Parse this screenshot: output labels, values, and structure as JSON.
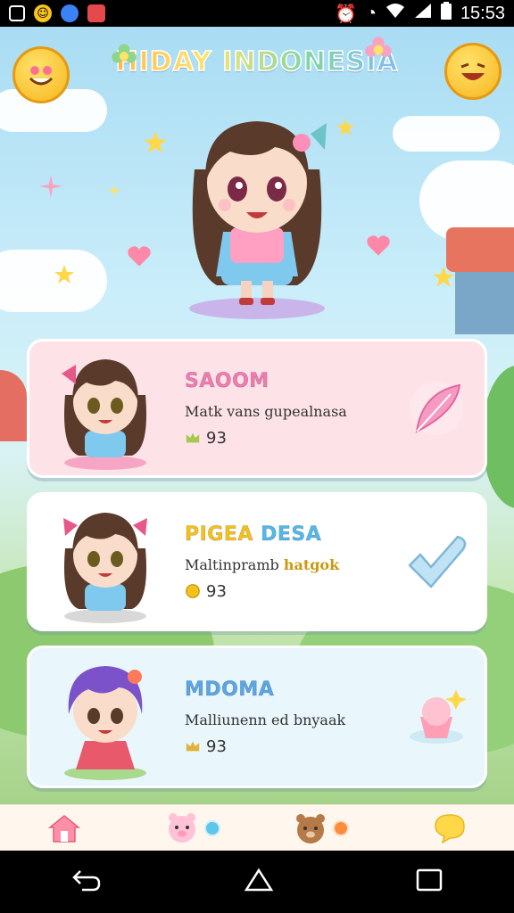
{
  "status_bar": {
    "time": "15:53"
  },
  "header": {
    "title": "HIDAY INDONESIA"
  },
  "cards": [
    {
      "name": "SAOOM",
      "description": "Matk vans gupealnasa",
      "stat": "93",
      "name_color": "#f27bb0",
      "stat_icon": "crown-icon",
      "action_icon": "feather-icon"
    },
    {
      "name_part1": "PIGEA",
      "name_part2": "DESA",
      "description": "Maltinpramb",
      "description_highlight": "hatgok",
      "stat": "93",
      "name_color1": "#f5c21b",
      "name_color2": "#54b8e8",
      "stat_icon": "coin-icon",
      "action_icon": "checkmark-icon"
    },
    {
      "name": "MDOMA",
      "description": "Malliunenn ed bnyaak",
      "stat": "93",
      "name_color": "#5aa6e6",
      "stat_icon": "crown-icon",
      "action_icon": "cupcake-icon"
    }
  ],
  "tab_bar": [
    "home-icon",
    "pig-icon",
    "bear-icon",
    "chat-bubble-icon"
  ],
  "colors": {
    "card1_bg": "#fde3e8",
    "card2_bg": "#ffffff",
    "card3_bg": "#e9f6fb",
    "accent_pink": "#f27bb0"
  }
}
